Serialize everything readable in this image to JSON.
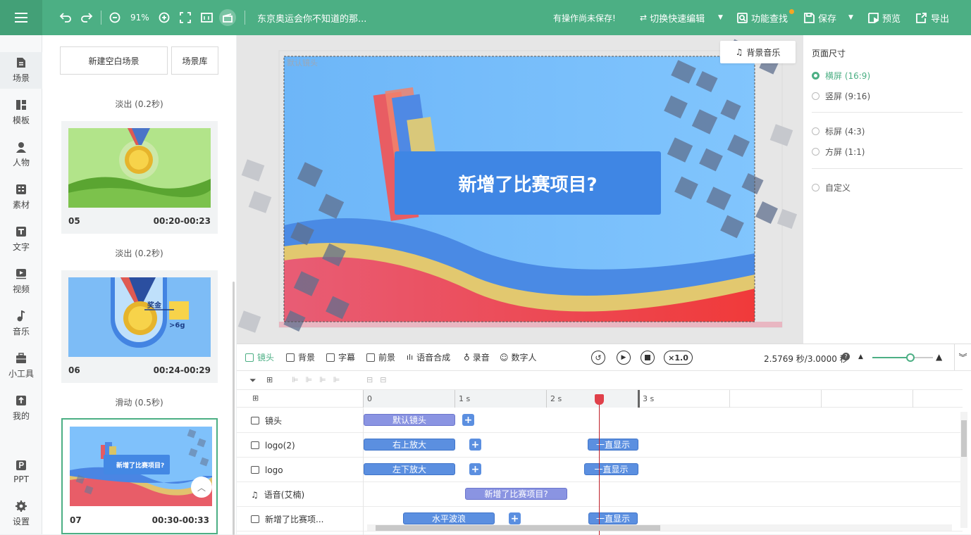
{
  "topbar": {
    "zoom": "91%",
    "doc_title": "东京奥运会你不知道的那...",
    "unsaved": "有操作尚未保存!",
    "quick_edit": "切换快速编辑",
    "feature_search": "功能查找",
    "save": "保存",
    "preview": "预览",
    "export": "导出",
    "accent": "#4caf84"
  },
  "rail": {
    "items": [
      {
        "label": "场景",
        "icon": "scene-icon"
      },
      {
        "label": "模板",
        "icon": "template-icon"
      },
      {
        "label": "人物",
        "icon": "person-icon"
      },
      {
        "label": "素材",
        "icon": "material-icon"
      },
      {
        "label": "文字",
        "icon": "text-icon"
      },
      {
        "label": "视频",
        "icon": "video-icon"
      },
      {
        "label": "音乐",
        "icon": "music-icon"
      },
      {
        "label": "小工具",
        "icon": "toolbox-icon"
      },
      {
        "label": "我的",
        "icon": "upload-icon"
      },
      {
        "label": "PPT",
        "icon": "ppt-icon"
      },
      {
        "label": "设置",
        "icon": "settings-icon"
      }
    ]
  },
  "scenes": {
    "new_blank": "新建空白场景",
    "library": "场景库",
    "transitions": [
      "淡出 (0.2秒)",
      "淡出 (0.2秒)",
      "滑动 (0.5秒)"
    ],
    "cards": [
      {
        "num": "05",
        "time": "00:20-00:23"
      },
      {
        "num": "06",
        "time": "00:24-00:29",
        "thumb_text_a": "奖金",
        "thumb_text_b": ">6g"
      },
      {
        "num": "07",
        "time": "00:30-00:33",
        "thumb_text": "新增了比赛项目?"
      }
    ]
  },
  "stage": {
    "camera_label": "默认镜头",
    "bg_music": "背景音乐",
    "headline": "新增了比赛项目?"
  },
  "page_size": {
    "title": "页面尺寸",
    "options": [
      {
        "label": "横屏 (16:9)",
        "selected": true
      },
      {
        "label": "竖屏 (9:16)",
        "selected": false
      },
      {
        "label": "标屏 (4:3)",
        "selected": false
      },
      {
        "label": "方屏 (1:1)",
        "selected": false
      },
      {
        "label": "自定义",
        "selected": false
      }
    ]
  },
  "timeline": {
    "tabs": [
      "镜头",
      "背景",
      "字幕",
      "前景",
      "语音合成",
      "录音",
      "数字人"
    ],
    "speed": "×1.0",
    "time_readout": "2.5769 秒/3.0000 秒",
    "ticks": [
      "0",
      "1 s",
      "2 s",
      "3 s"
    ],
    "rows": [
      {
        "label": "镜头",
        "clip": "默认镜头"
      },
      {
        "label": "logo(2)",
        "clip": "右上放大",
        "clip2": "一直显示"
      },
      {
        "label": "logo",
        "clip": "左下放大",
        "clip2": "一直显示"
      },
      {
        "label": "语音(艾楠)",
        "clip": "新增了比赛项目?"
      },
      {
        "label": "新增了比赛项...",
        "clip": "水平波浪",
        "clip2": "一直显示"
      }
    ]
  }
}
